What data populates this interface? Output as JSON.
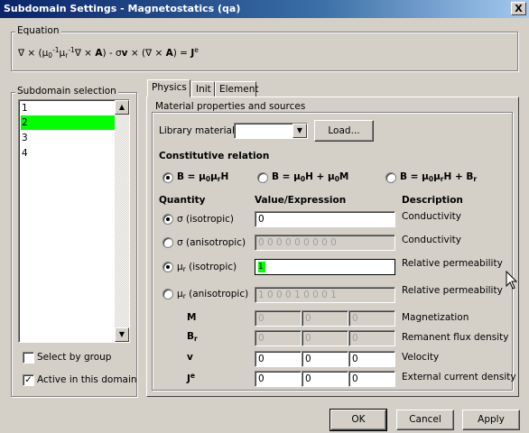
{
  "window": {
    "title": "Subdomain Settings - Magnetostatics (qa)",
    "close_label": "X"
  },
  "equation": {
    "group_label": "Equation"
  },
  "subdomain": {
    "group_label": "Subdomain selection",
    "items": [
      "1",
      "2",
      "3",
      "4"
    ],
    "selected": "2",
    "select_by_group": "Select by group",
    "select_by_group_checked": false,
    "active_in_domain": "Active in this domain",
    "active_in_domain_checked": true
  },
  "tabs": [
    {
      "label": "Physics",
      "active": true
    },
    {
      "label": "Init"
    },
    {
      "label": "Element"
    }
  ],
  "material": {
    "group_label": "Material properties and sources",
    "library_label": "Library material:",
    "library_value": "",
    "load_button": "Load..."
  },
  "constitutive": {
    "heading": "Constitutive relation",
    "selected_index": 0
  },
  "columns": {
    "quantity": "Quantity",
    "value": "Value/Expression",
    "description": "Description"
  },
  "rows": {
    "sigma_iso": {
      "label": "σ (isotropic)",
      "value": "0",
      "description": "Conductivity"
    },
    "sigma_aniso": {
      "label": "σ (anisotropic)",
      "value": "0 0 0 0 0 0 0 0 0",
      "description": "Conductivity"
    },
    "mu_iso": {
      "label_suffix": " (isotropic)",
      "value": "1",
      "description": "Relative permeability"
    },
    "mu_aniso": {
      "label_suffix": " (anisotropic)",
      "value": "1 0 0 0 1 0 0 0 1",
      "description": "Relative permeability"
    },
    "M": {
      "label": "M",
      "values": [
        "0",
        "0",
        "0"
      ],
      "description": "Magnetization"
    },
    "Br": {
      "values": [
        "0",
        "0",
        "0"
      ],
      "description": "Remanent flux density"
    },
    "v": {
      "label": "v",
      "values": [
        "0",
        "0",
        "0"
      ],
      "description": "Velocity"
    },
    "Je": {
      "values": [
        "0",
        "0",
        "0"
      ],
      "description": "External current density"
    }
  },
  "buttons": {
    "ok": "OK",
    "cancel": "Cancel",
    "apply": "Apply"
  }
}
